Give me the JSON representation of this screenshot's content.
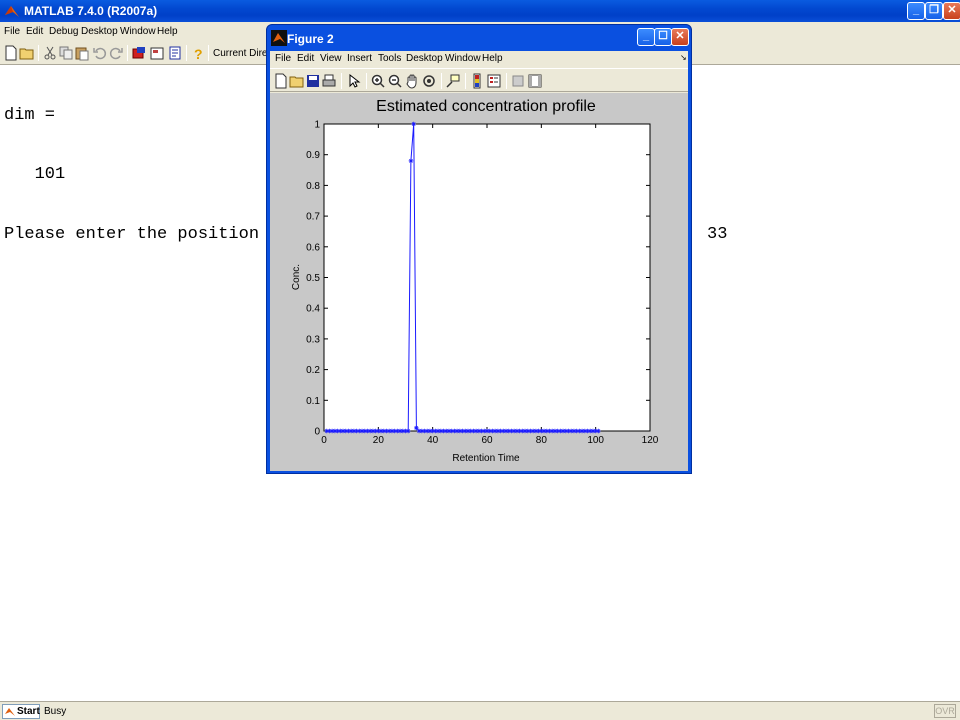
{
  "app": {
    "title": "MATLAB  7.4.0 (R2007a)",
    "menu": [
      "File",
      "Edit",
      "Debug",
      "Desktop",
      "Window",
      "Help"
    ],
    "current_directory_label": "Current Directo"
  },
  "command_window": {
    "lines": [
      "dim =",
      "   101",
      "Please enter the position",
      "33"
    ]
  },
  "status": {
    "start_label": "Start",
    "text": "Busy",
    "ovr": "OVR"
  },
  "figure": {
    "window_title": "Figure 2",
    "menu": [
      "File",
      "Edit",
      "View",
      "Insert",
      "Tools",
      "Desktop",
      "Window",
      "Help"
    ],
    "series_color": "#1a1aff"
  },
  "chart_data": {
    "type": "line",
    "title": "Estimated concentration profile",
    "xlabel": "Retention Time",
    "ylabel": "Conc.",
    "xlim": [
      0,
      120
    ],
    "ylim": [
      0,
      1
    ],
    "xticks": [
      "0",
      "20",
      "40",
      "60",
      "80",
      "100",
      "120"
    ],
    "yticks": [
      "0",
      "0.1",
      "0.2",
      "0.3",
      "0.4",
      "0.5",
      "0.6",
      "0.7",
      "0.8",
      "0.9",
      "1"
    ],
    "marker": "*",
    "series": [
      {
        "x": [
          1,
          2,
          3,
          4,
          5,
          6,
          7,
          8,
          9,
          10,
          11,
          12,
          13,
          14,
          15,
          16,
          17,
          18,
          19,
          20,
          21,
          22,
          23,
          24,
          25,
          26,
          27,
          28,
          29,
          30,
          31,
          32,
          33,
          34,
          35,
          36,
          37,
          38,
          39,
          40,
          41,
          42,
          43,
          44,
          45,
          46,
          47,
          48,
          49,
          50,
          51,
          52,
          53,
          54,
          55,
          56,
          57,
          58,
          59,
          60,
          61,
          62,
          63,
          64,
          65,
          66,
          67,
          68,
          69,
          70,
          71,
          72,
          73,
          74,
          75,
          76,
          77,
          78,
          79,
          80,
          81,
          82,
          83,
          84,
          85,
          86,
          87,
          88,
          89,
          90,
          91,
          92,
          93,
          94,
          95,
          96,
          97,
          98,
          99,
          100,
          101
        ],
        "y": [
          0,
          0,
          0,
          0,
          0,
          0,
          0,
          0,
          0,
          0,
          0,
          0,
          0,
          0,
          0,
          0,
          0,
          0,
          0,
          0,
          0,
          0,
          0,
          0,
          0,
          0,
          0,
          0,
          0,
          0,
          0,
          0.88,
          1,
          0.01,
          0,
          0,
          0,
          0,
          0,
          0,
          0,
          0,
          0,
          0,
          0,
          0,
          0,
          0,
          0,
          0,
          0,
          0,
          0,
          0,
          0,
          0,
          0,
          0,
          0,
          0,
          0,
          0,
          0,
          0,
          0,
          0,
          0,
          0,
          0,
          0,
          0,
          0,
          0,
          0,
          0,
          0,
          0,
          0,
          0,
          0,
          0,
          0,
          0,
          0,
          0,
          0,
          0,
          0,
          0,
          0,
          0,
          0,
          0,
          0,
          0,
          0,
          0,
          0,
          0,
          0,
          0
        ]
      }
    ]
  }
}
